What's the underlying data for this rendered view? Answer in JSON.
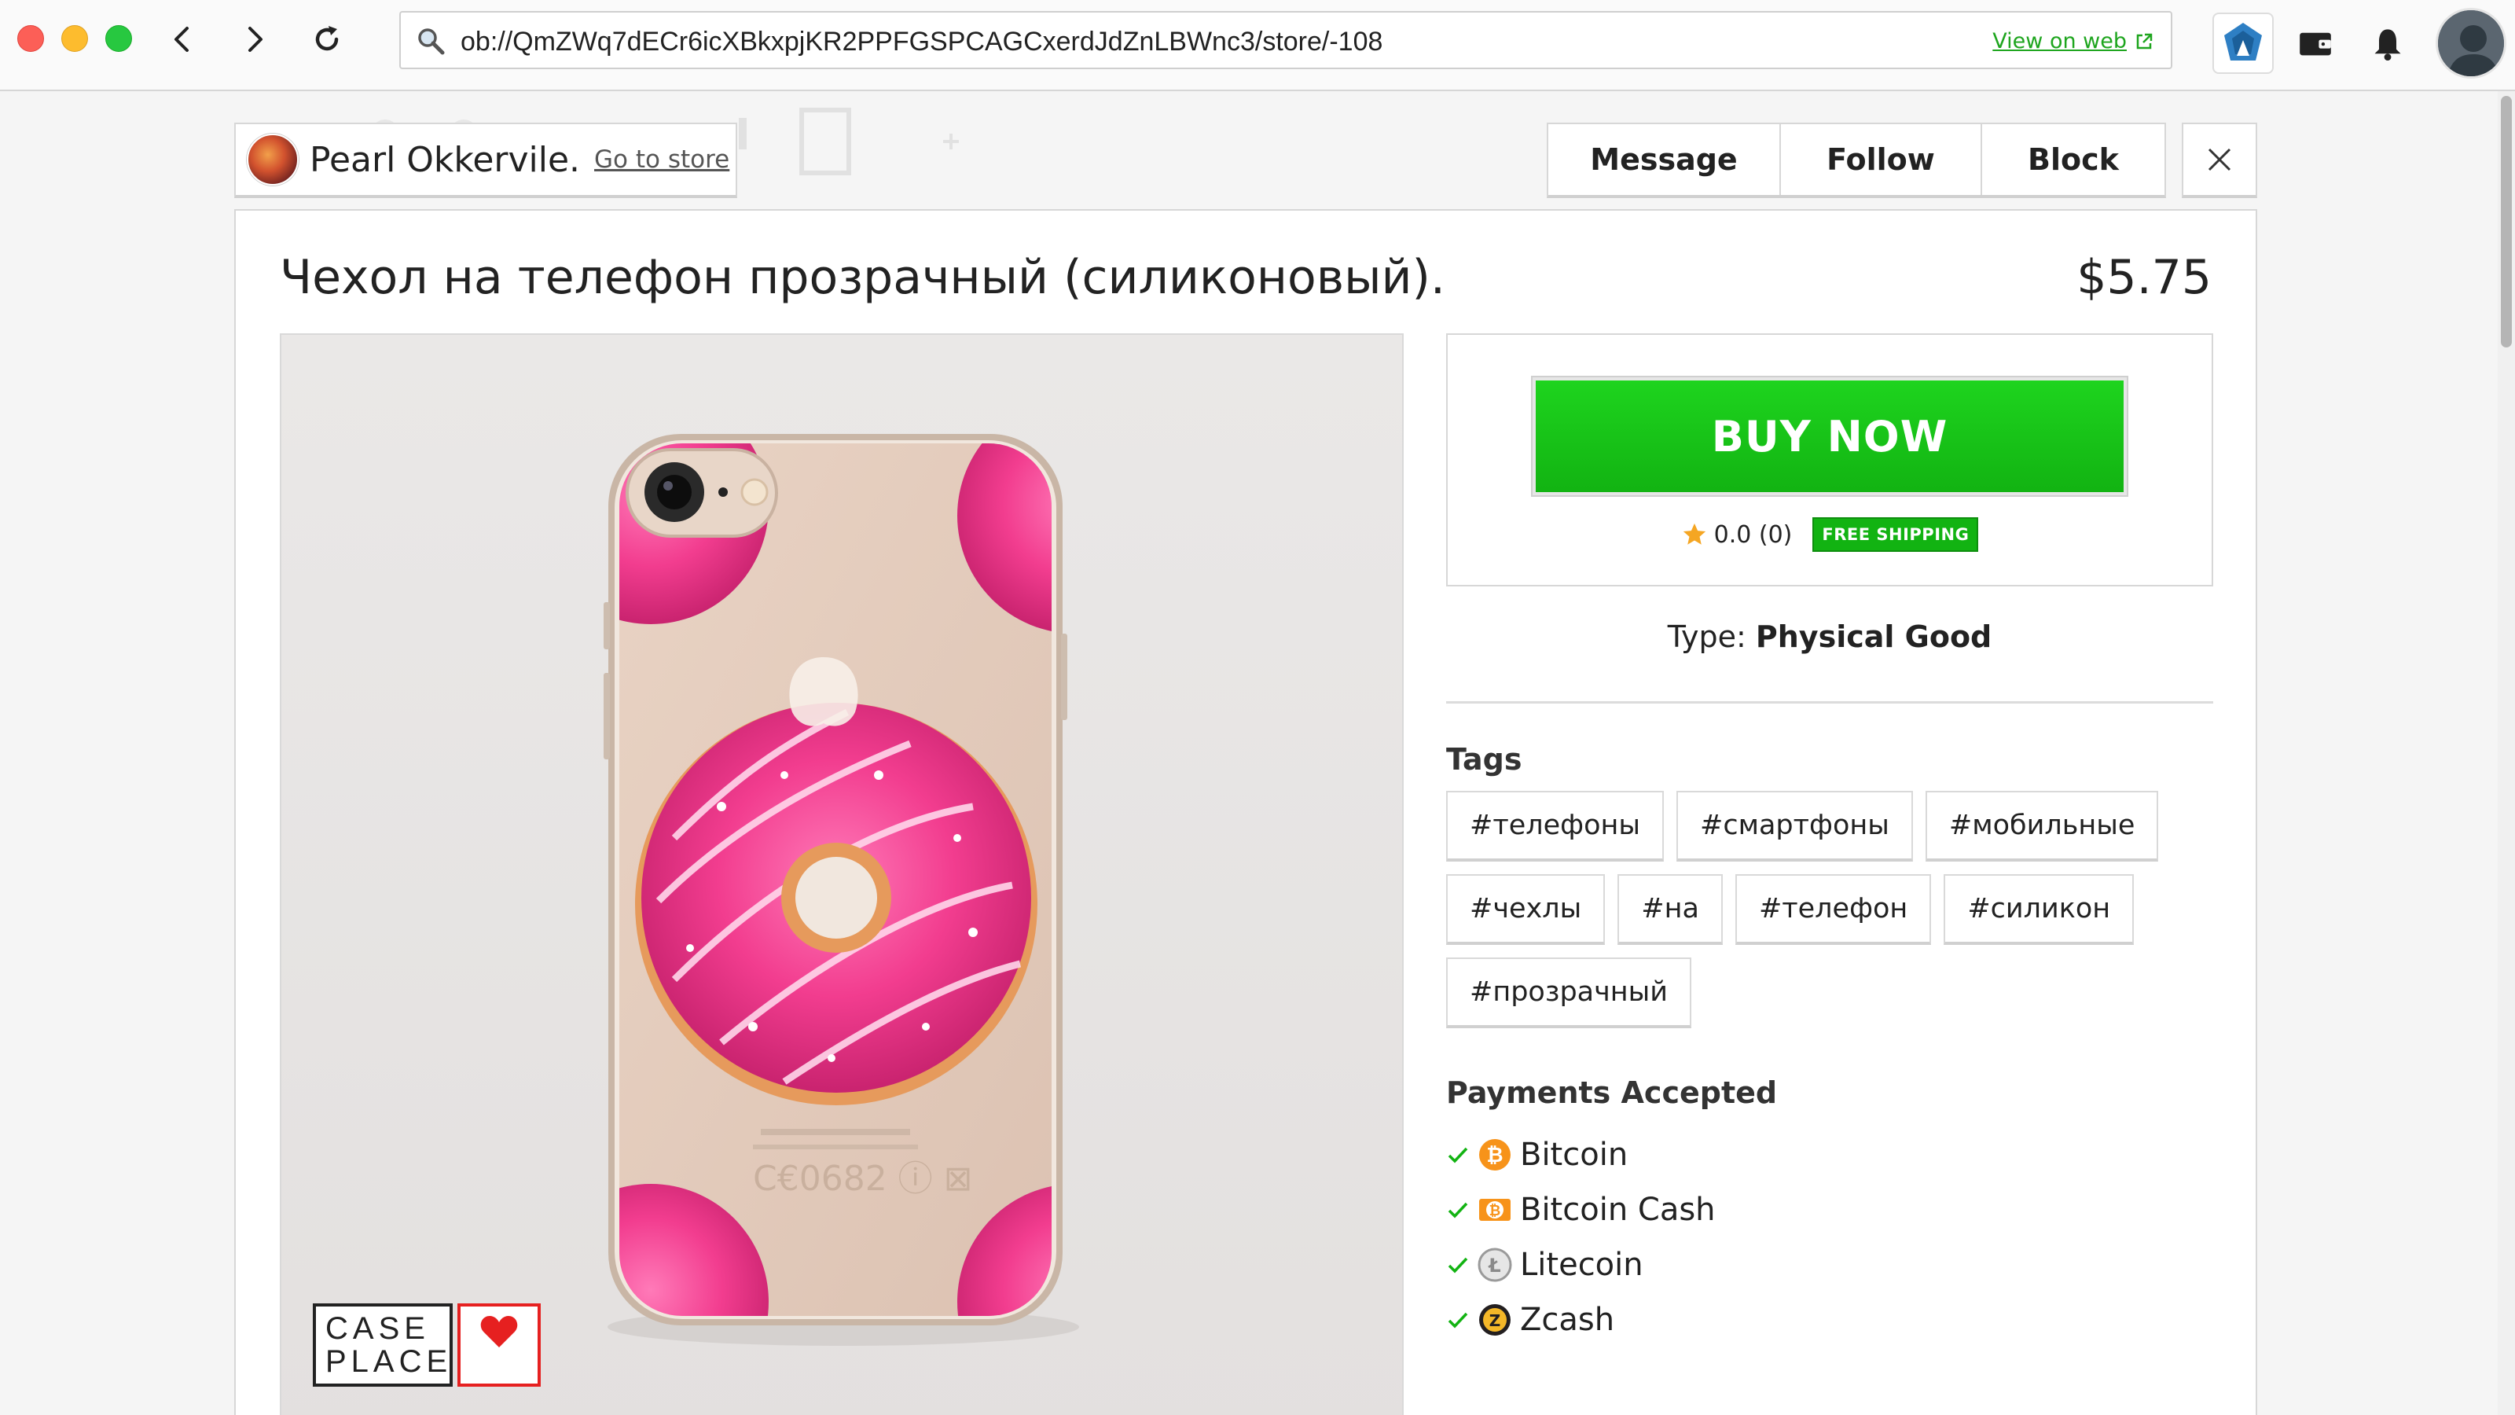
{
  "browser": {
    "url": "ob://QmZWq7dECr6icXBkxpjKR2PPFGSPCAGCxerdJdZnLBWnc3/store/-108",
    "view_on_web": "View on web"
  },
  "store": {
    "name": "Pearl Okkervile.",
    "go_to_store": "Go to store"
  },
  "actions": {
    "message": "Message",
    "follow": "Follow",
    "block": "Block"
  },
  "listing": {
    "title": "Чехол на телефон прозрачный (силиконовый).",
    "price": "$5.75",
    "image_brand_line1": "CASE",
    "image_brand_line2": "PLACE",
    "buy_now": "BUY NOW",
    "rating": "0.0 (0)",
    "free_shipping": "FREE SHIPPING",
    "type_label": "Type:",
    "type_value": "Physical Good",
    "tags_heading": "Tags",
    "tags": [
      "#телефоны",
      "#смартфоны",
      "#мобильные",
      "#чехлы",
      "#на",
      "#телефон",
      "#силикон",
      "#прозрачный"
    ],
    "payments_heading": "Payments Accepted",
    "payments": [
      "Bitcoin",
      "Bitcoin Cash",
      "Litecoin",
      "Zcash"
    ]
  },
  "colors": {
    "accent_green": "#12b312",
    "link_green": "#1ea51e",
    "bitcoin": "#f7931a",
    "zcash": "#f4b728",
    "litecoin": "#bfbbbb"
  }
}
